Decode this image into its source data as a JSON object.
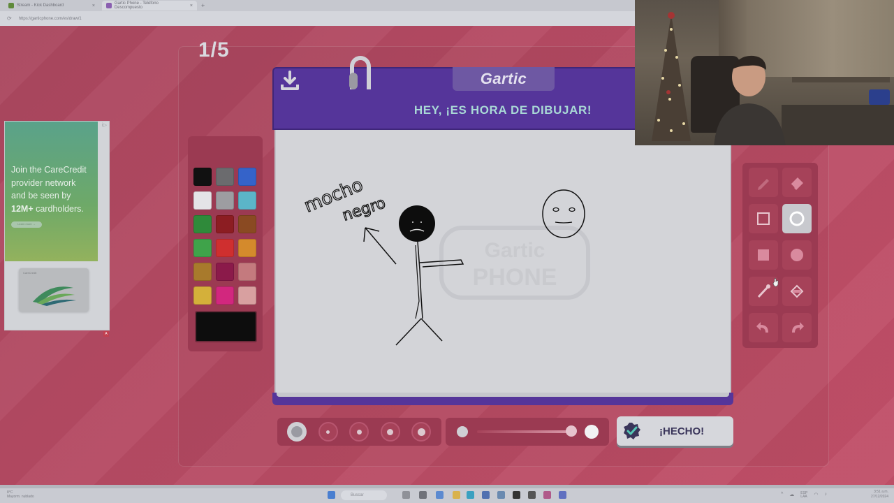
{
  "browser": {
    "tabs": [
      {
        "label": "Stream - Kick Dashboard",
        "active": false,
        "color": "#5f8a3a"
      },
      {
        "label": "Gartic Phone - Teléfono Descompuesto",
        "active": true,
        "color": "#8a5fb0"
      }
    ],
    "new_tab": "+",
    "url": "https://garticphone.com/es/draw/1"
  },
  "game": {
    "round": "1/5",
    "logo": "Gartic",
    "headline": "HEY, ¡ES HORA DE DIBUJAR!",
    "done_label": "¡HECHO!",
    "drawing_text": [
      "mocho",
      "negro"
    ],
    "watermark": "Gartic PHONE"
  },
  "palette": {
    "colors": [
      "#111111",
      "#6b6b6e",
      "#3563c9",
      "#e4e4e7",
      "#9d9da1",
      "#5bb5c8",
      "#2f8a3a",
      "#8c1d22",
      "#8a4a22",
      "#3fa34a",
      "#cf2f2f",
      "#d48a2c",
      "#a87a2c",
      "#8b1a4a",
      "#c47a7e",
      "#d4b03a",
      "#d2277e",
      "#d8a0a0"
    ],
    "current_color": "#0d0d0d"
  },
  "tools": [
    {
      "name": "pencil-tool",
      "selected": false
    },
    {
      "name": "eraser-tool",
      "selected": false
    },
    {
      "name": "rectangle-outline-tool",
      "selected": false
    },
    {
      "name": "ellipse-outline-tool",
      "selected": true
    },
    {
      "name": "rectangle-fill-tool",
      "selected": false
    },
    {
      "name": "ellipse-fill-tool",
      "selected": false
    },
    {
      "name": "line-tool",
      "selected": false
    },
    {
      "name": "bucket-tool",
      "selected": false
    },
    {
      "name": "undo-tool",
      "selected": false
    },
    {
      "name": "redo-tool",
      "selected": false
    }
  ],
  "brush_sizes": {
    "selected_index": 0,
    "count": 5
  },
  "opacity": {
    "value": 0.9
  },
  "ad": {
    "line1": "Join the CareCredit",
    "line2": "provider network",
    "line3": "and be seen by",
    "highlight": "12M+",
    "line4": "cardholders.",
    "button": "Learn more →",
    "brand": "CareCredit",
    "info_icon": "i▷",
    "close_icon": "A"
  },
  "taskbar": {
    "weather": [
      "8°C",
      "Mayorm. nublado"
    ],
    "search": "Buscar",
    "time": "3:51 a.m.",
    "date": "27/12/2024",
    "lang": [
      "ESP",
      "LAA"
    ]
  }
}
